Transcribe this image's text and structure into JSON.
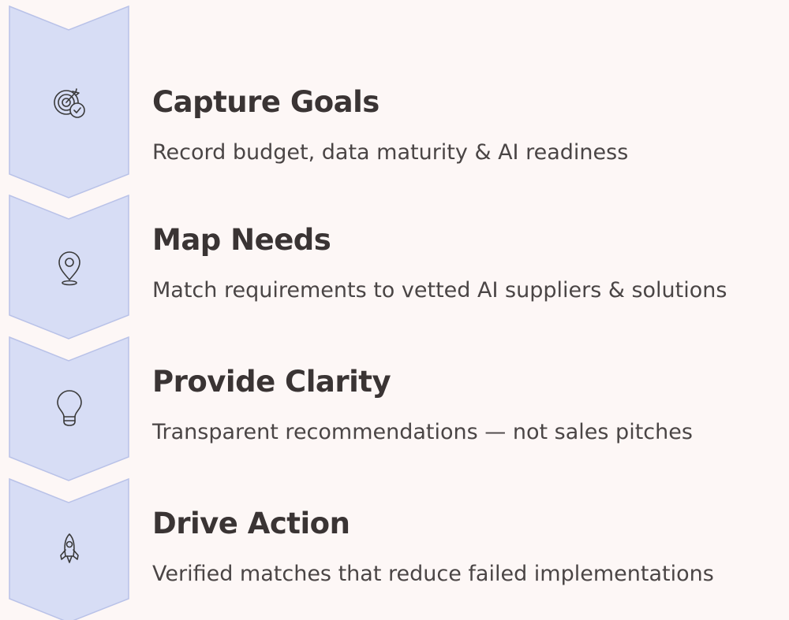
{
  "colors": {
    "background": "#fdf7f6",
    "chevron_fill": "#d7ddf5",
    "chevron_stroke": "#b9c2e8",
    "icon_stroke": "#3a3a3a",
    "title_text": "#3a3434",
    "description_text": "#4a4545"
  },
  "steps": [
    {
      "title": "Capture Goals",
      "description": "Record budget, data maturity & AI readiness",
      "icon": "target-check-icon"
    },
    {
      "title": "Map Needs",
      "description": "Match requirements to vetted AI suppliers & solutions",
      "icon": "map-pin-icon"
    },
    {
      "title": "Provide Clarity",
      "description": "Transparent recommendations — not sales pitches",
      "icon": "lightbulb-icon"
    },
    {
      "title": "Drive Action",
      "description": "Verified matches that reduce failed implementations",
      "icon": "rocket-icon"
    }
  ]
}
